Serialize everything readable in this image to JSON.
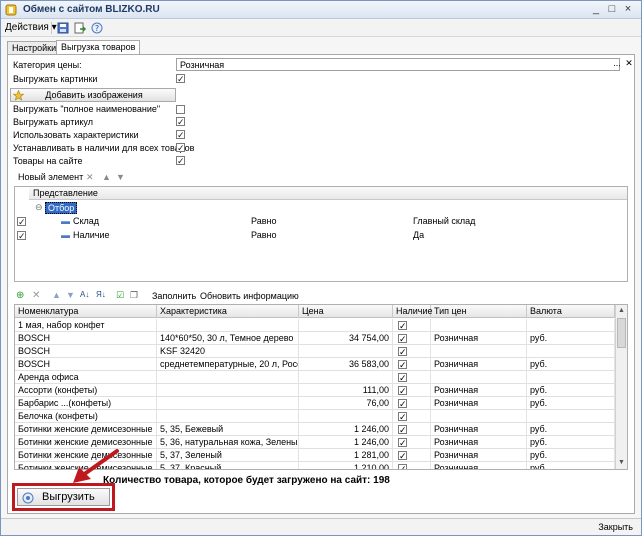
{
  "window": {
    "title": "Обмен с сайтом BLIZKO.RU"
  },
  "toolbar": {
    "actions_label": "Действия"
  },
  "tabs": [
    {
      "label": "Настройки"
    },
    {
      "label": "Выгрузка товаров"
    }
  ],
  "settings": {
    "price_category_label": "Категория цены:",
    "price_category_value": "Розничная",
    "upload_images_label": "Выгружать картинки",
    "add_images_button": "Добавить изображения",
    "full_name_label": "Выгружать \"полное наименование\"",
    "article_label": "Выгружать артикул",
    "characteristics_label": "Использовать характеристики",
    "in_stock_label": "Устанавливать в наличии для всех товаров",
    "on_site_label": "Товары на сайте"
  },
  "filter": {
    "new_element_label": "Новый элемент",
    "column_header": "Представление",
    "group_label": "Отбор",
    "rows": [
      {
        "field": "Склад",
        "condition": "Равно",
        "value": "Главный склад"
      },
      {
        "field": "Наличие",
        "condition": "Равно",
        "value": "Да"
      }
    ]
  },
  "goods": {
    "fill_link": "Заполнить",
    "update_link": "Обновить информацию",
    "columns": [
      "Номенклатура",
      "Характеристика",
      "Цена",
      "Наличие",
      "Тип цен",
      "Валюта"
    ],
    "rows": [
      {
        "name": "1 мая, набор конфет",
        "char": "",
        "price": "",
        "price_type": "",
        "currency": ""
      },
      {
        "name": "BOSCH",
        "char": "140*60*50, 30 л, Темное дерево",
        "price": "34 754,00",
        "price_type": "Розничная",
        "currency": "руб."
      },
      {
        "name": "BOSCH",
        "char": "KSF 32420",
        "price": "",
        "price_type": "",
        "currency": ""
      },
      {
        "name": "BOSCH",
        "char": "среднетемпературные, 20 л, Россия",
        "price": "36 583,00",
        "price_type": "Розничная",
        "currency": "руб."
      },
      {
        "name": "Аренда офиса",
        "char": "",
        "price": "",
        "price_type": "",
        "currency": ""
      },
      {
        "name": "Ассорти (конфеты)",
        "char": "",
        "price": "111,00",
        "price_type": "Розничная",
        "currency": "руб."
      },
      {
        "name": "Барбарис ...(конфеты)",
        "char": "",
        "price": "76,00",
        "price_type": "Розничная",
        "currency": "руб."
      },
      {
        "name": "Белочка (конфеты)",
        "char": "",
        "price": "",
        "price_type": "",
        "currency": ""
      },
      {
        "name": "Ботинки женские демисезонные",
        "char": "5, 35, Бежевый",
        "price": "1 246,00",
        "price_type": "Розничная",
        "currency": "руб."
      },
      {
        "name": "Ботинки женские демисезонные",
        "char": "5, 36, натуральная кожа, Зеленый",
        "price": "1 246,00",
        "price_type": "Розничная",
        "currency": "руб."
      },
      {
        "name": "Ботинки женские демисезонные",
        "char": "5, 37, Зеленый",
        "price": "1 281,00",
        "price_type": "Розничная",
        "currency": "руб."
      },
      {
        "name": "Ботинки женские демисезонные",
        "char": "5, 37, Красный",
        "price": "1 210,00",
        "price_type": "Розничная",
        "currency": "руб."
      }
    ]
  },
  "footer": {
    "count_text": "Количество товара, которое будет загружено на сайт: 198",
    "upload_button": "Выгрузить",
    "close_link": "Закрыть"
  }
}
